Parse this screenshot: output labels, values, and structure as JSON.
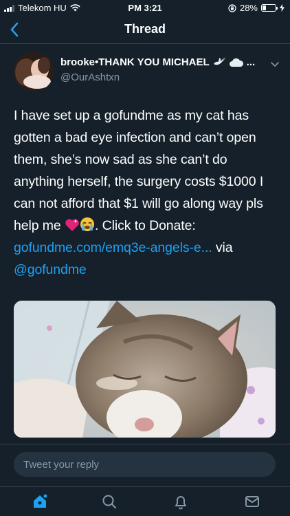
{
  "status_bar": {
    "carrier": "Telekom HU",
    "time": "PM 3:21",
    "battery_percent": "28%",
    "battery_level": 0.28
  },
  "nav": {
    "title": "Thread",
    "back_icon": "chevron-left-icon"
  },
  "tweet": {
    "author_name": "brooke•THANK YOU MICHAEL",
    "author_name_suffix": "...",
    "handle": "@OurAshtxn",
    "text_part1": "I have set up a gofundme as my cat has gotten a bad eye infection and can’t open them, she’s now sad as she can’t do anything herself, the surgery costs $1000 I can not afford that $1 will go along way pls help me ",
    "text_part2": ". Click to Donate: ",
    "link": "gofundme.com/emq3e-angels-e...",
    "via": " via ",
    "mention": "@gofundme",
    "emojis": [
      "heart-icon",
      "crying-face-icon"
    ],
    "media_description_icon": "cat-photo"
  },
  "reply": {
    "placeholder": "Tweet your reply"
  },
  "tabs": [
    {
      "name": "home",
      "icon": "home-icon",
      "active": true
    },
    {
      "name": "search",
      "icon": "search-icon",
      "active": false
    },
    {
      "name": "notifications",
      "icon": "bell-icon",
      "active": false
    },
    {
      "name": "messages",
      "icon": "mail-icon",
      "active": false
    }
  ],
  "colors": {
    "background": "#15202b",
    "accent": "#1da1f2",
    "secondary_text": "#8899a6",
    "divider": "#38444d"
  }
}
